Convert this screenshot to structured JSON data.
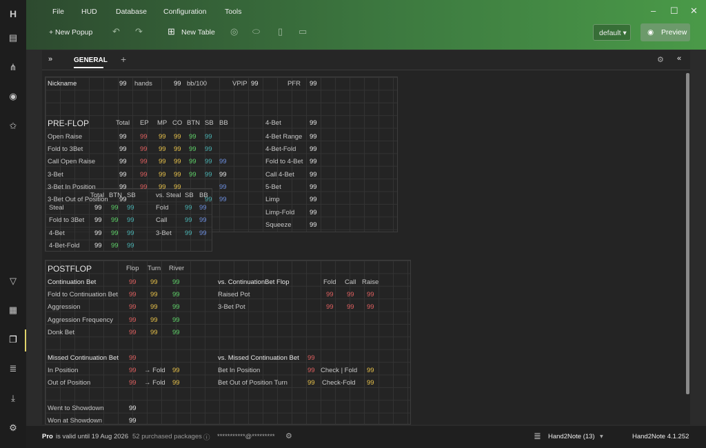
{
  "menu": [
    "File",
    "HUD",
    "Database",
    "Configuration",
    "Tools"
  ],
  "toolbar": {
    "new_popup": "+ New Popup",
    "new_table": "New Table",
    "profile": "default",
    "preview": "Preview"
  },
  "tab": {
    "name": "GENERAL"
  },
  "top": {
    "nickname": "Nickname",
    "v1": "99",
    "hands": "hands",
    "v2": "99",
    "bb100": "bb/100",
    "vpip": "VPIP",
    "v3": "99",
    "pfr": "PFR",
    "v4": "99"
  },
  "preflop": {
    "title": "PRE-FLOP",
    "cols": [
      "Total",
      "EP",
      "MP",
      "CO",
      "BTN",
      "SB",
      "BB"
    ],
    "rows": [
      "Open Raise",
      "Fold to 3Bet",
      "Call Open Raise",
      "3-Bet",
      "3-Bet In Position",
      "3-Bet Out of Position"
    ],
    "right": [
      "4-Bet",
      "4-Bet Range",
      "4-Bet-Fold",
      "Fold to 4-Bet",
      "Call 4-Bet",
      "5-Bet",
      "Limp",
      "Limp-Fold",
      "Squeeze"
    ]
  },
  "steal": {
    "cols": [
      "Total",
      "BTN",
      "SB"
    ],
    "rows": [
      "Steal",
      "Fold to 3Bet",
      "4-Bet",
      "4-Bet-Fold"
    ],
    "vs_header": "vs. Steal",
    "vs_cols": [
      "SB",
      "BB"
    ],
    "vs_rows": [
      "Fold",
      "Call",
      "3-Bet"
    ]
  },
  "postflop": {
    "title": "POSTFLOP",
    "cols": [
      "Flop",
      "Turn",
      "River"
    ],
    "rows": [
      "Continuation Bet",
      "Fold to Continuation Bet",
      "Aggression",
      "Aggression Frequency",
      "Donk Bet"
    ],
    "vs_cb": "vs. ContinuationBet Flop",
    "vs_cols": [
      "Fold",
      "Call",
      "Raise"
    ],
    "vs_rows": [
      "Raised Pot",
      "3-Bet Pot"
    ],
    "missed": "Missed Continuation Bet",
    "in_pos": "In Position",
    "out_pos": "Out of Position",
    "arrow_fold": "→ Fold",
    "vs_missed": "vs. Missed Continuation Bet",
    "bet_in": "Bet In Position",
    "bet_out": "Bet Out of Position Turn",
    "check_fold": "Check | Fold",
    "check_fold2": "Check-Fold",
    "wtsd": "Went to Showdown",
    "wsd": "Won at Showdown",
    "val": "99"
  },
  "status": {
    "pro": "Pro",
    "valid": "is valid until 19 Aug 2026",
    "packages": "52 purchased packages",
    "email": "***********@*********",
    "db": "Hand2Note (13)",
    "version": "Hand2Note 4.1.252"
  }
}
